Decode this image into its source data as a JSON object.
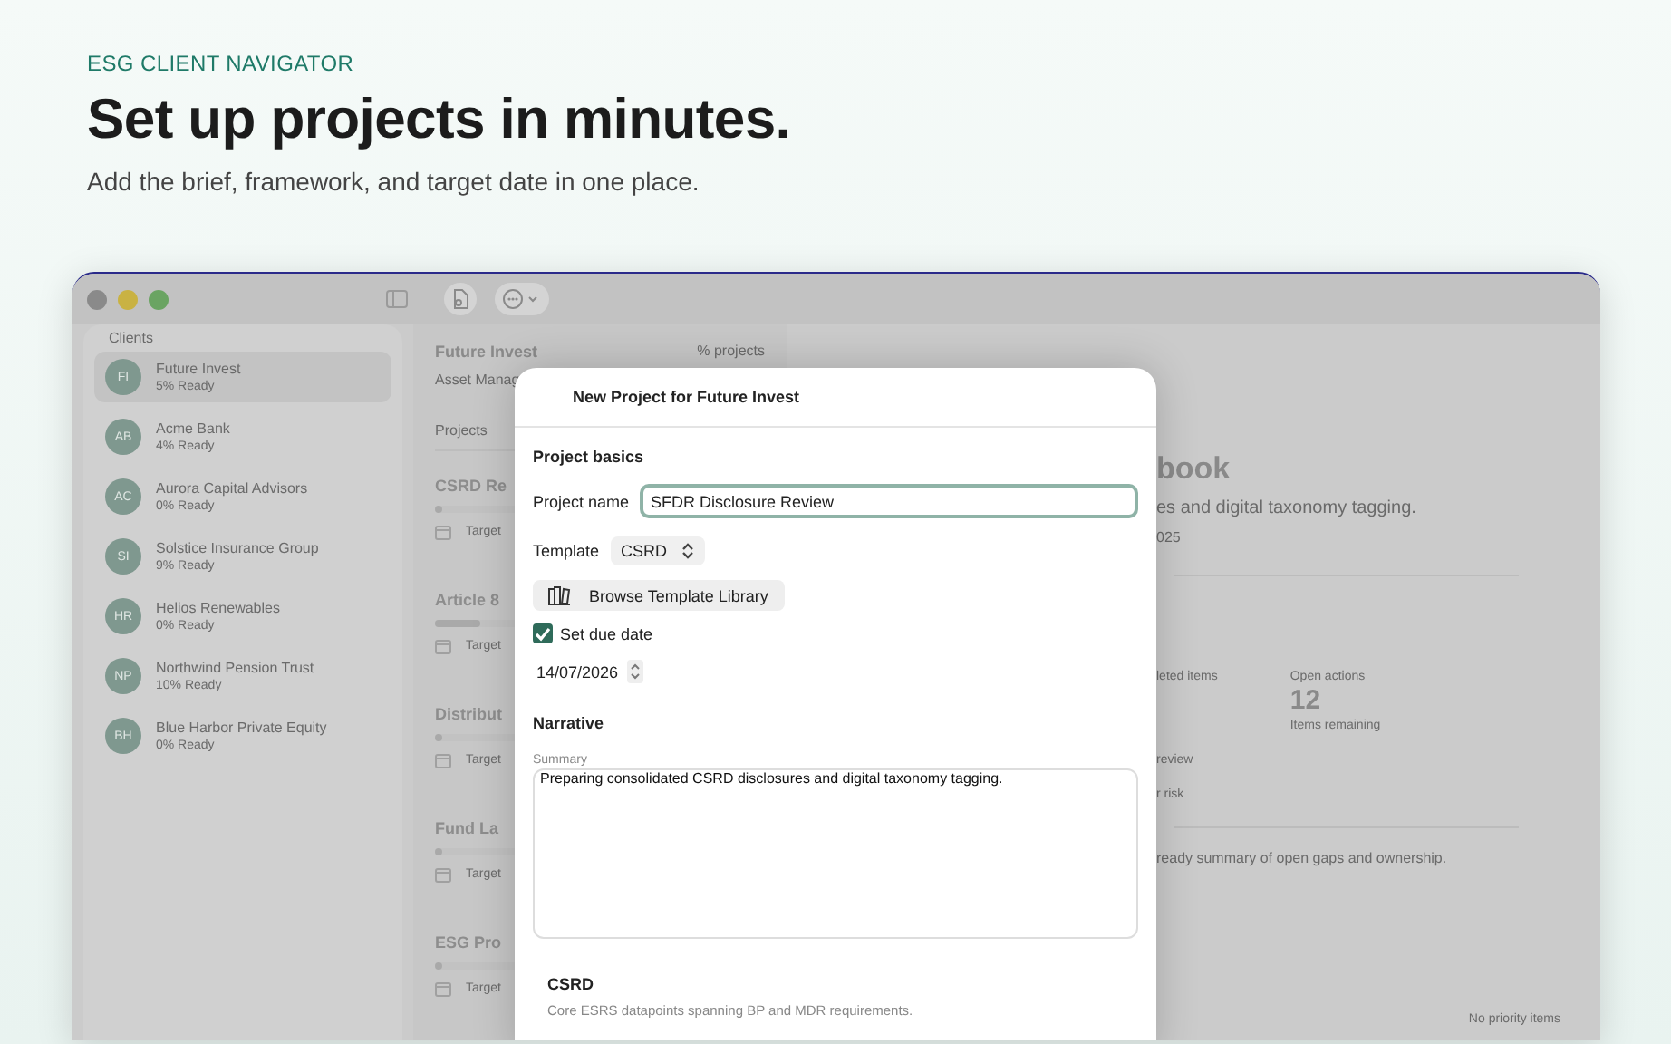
{
  "hero": {
    "eyebrow": "ESG CLIENT NAVIGATOR",
    "title": "Set up projects in minutes.",
    "subtitle": "Add the brief, framework, and target date in one place."
  },
  "sidebar": {
    "heading": "Clients",
    "items": [
      {
        "initials": "FI",
        "name": "Future Invest",
        "ready": "5% Ready",
        "selected": true
      },
      {
        "initials": "AB",
        "name": "Acme Bank",
        "ready": "4% Ready",
        "selected": false
      },
      {
        "initials": "AC",
        "name": "Aurora Capital Advisors",
        "ready": "0% Ready",
        "selected": false
      },
      {
        "initials": "SI",
        "name": "Solstice Insurance Group",
        "ready": "9% Ready",
        "selected": false
      },
      {
        "initials": "HR",
        "name": "Helios Renewables",
        "ready": "0% Ready",
        "selected": false
      },
      {
        "initials": "NP",
        "name": "Northwind Pension Trust",
        "ready": "10% Ready",
        "selected": false
      },
      {
        "initials": "BH",
        "name": "Blue Harbor Private Equity",
        "ready": "0% Ready",
        "selected": false
      }
    ]
  },
  "client": {
    "name": "Future Invest",
    "type": "Asset Manag",
    "count": "% projects",
    "section": "Projects",
    "projects": [
      {
        "title": "CSRD Re",
        "target": "Target",
        "level": 0.02
      },
      {
        "title": "Article 8",
        "target": "Target",
        "level": 0.14
      },
      {
        "title": "Distribut",
        "target": "Target",
        "level": 0.02
      },
      {
        "title": "Fund La",
        "target": "Target",
        "level": 0.02
      },
      {
        "title": "ESG Pro",
        "target": "Target",
        "level": 0.02
      }
    ]
  },
  "detail": {
    "title": "book",
    "summary": "es and digital taxonomy tagging.",
    "date": "025",
    "stats": [
      {
        "label": "leted items"
      },
      {
        "label": "Open actions",
        "value": "12",
        "note": "Items remaining"
      }
    ],
    "rows": [
      "review",
      "r risk"
    ],
    "report": "ready summary of open gaps and ownership.",
    "priority": "No priority items"
  },
  "dialog": {
    "title": "New Project for Future Invest",
    "basics": "Project basics",
    "name_label": "Project name",
    "name_value": "SFDR Disclosure Review",
    "template_label": "Template",
    "template_value": "CSRD",
    "browse": "Browse Template Library",
    "due": {
      "label": "Set due date",
      "checked": true
    },
    "date": "14/07/2026",
    "narrative": "Narrative",
    "summary_label": "Summary",
    "summary_value": "Preparing consolidated CSRD disclosures and digital taxonomy tagging.",
    "framework": {
      "name": "CSRD",
      "description": "Core ESRS datapoints spanning BP and MDR requirements."
    }
  }
}
